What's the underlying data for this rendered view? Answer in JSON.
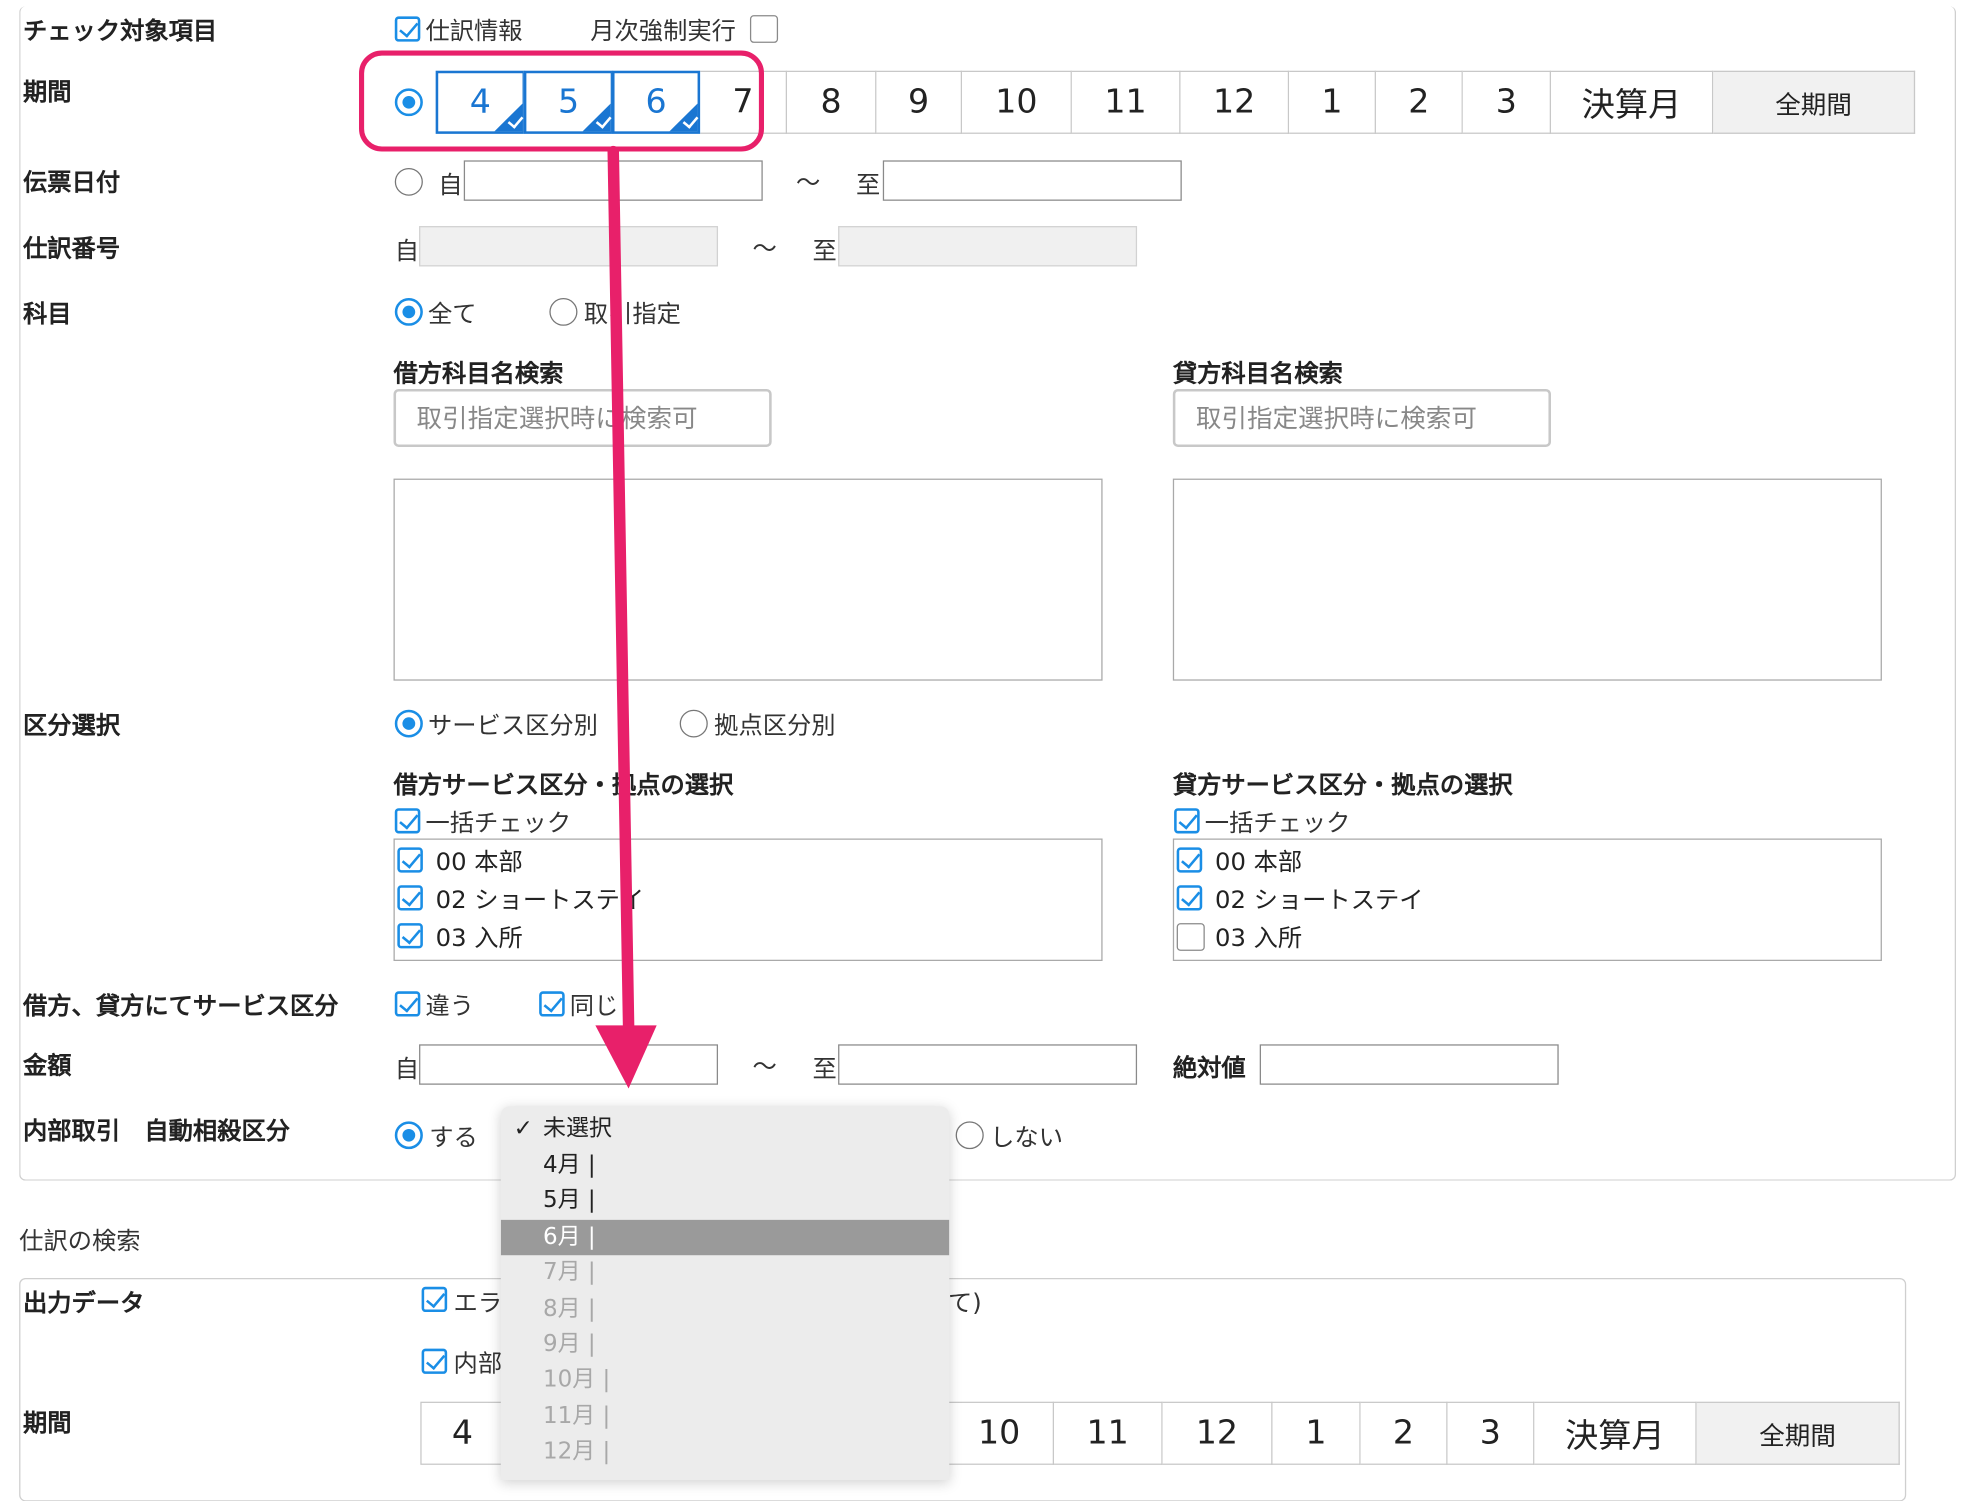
{
  "check": {
    "heading": "チェック対象項目",
    "shiwake_label": "仕訳情報",
    "getsuji_label": "月次強制実行"
  },
  "period": {
    "label": "期間",
    "months": [
      "4",
      "5",
      "6",
      "7",
      "8",
      "9",
      "10",
      "11",
      "12",
      "1",
      "2",
      "3",
      "決算月"
    ],
    "selected": [
      "4",
      "5",
      "6"
    ],
    "all_label": "全期間"
  },
  "voucher_date": {
    "label": "伝票日付",
    "from": "自",
    "tilde": "〜",
    "to": "至"
  },
  "entry_number": {
    "label": "仕訳番号",
    "from": "自",
    "tilde": "〜",
    "to": "至"
  },
  "account": {
    "label": "科目",
    "opt_all": "全て",
    "opt_specified": "取引指定",
    "debit_search_title": "借方科目名検索",
    "credit_search_title": "貸方科目名検索",
    "search_placeholder": "取引指定選択時に検索可"
  },
  "division": {
    "label": "区分選択",
    "opt_service": "サービス区分別",
    "opt_base": "拠点区分別",
    "debit_title": "借方サービス区分・拠点の選択",
    "credit_title": "貸方サービス区分・拠点の選択",
    "bulk_check": "一括チェック",
    "debit_items": [
      {
        "label": "00 本部",
        "checked": true
      },
      {
        "label": "02 ショートステイ",
        "checked": true
      },
      {
        "label": "03 入所",
        "checked": true
      }
    ],
    "credit_items": [
      {
        "label": "00 本部",
        "checked": true
      },
      {
        "label": "02 ショートステイ",
        "checked": true
      },
      {
        "label": "03 入所",
        "checked": false
      }
    ]
  },
  "service_compare": {
    "label": "借方、貸方にてサービス区分",
    "diff": "違う",
    "same": "同じ"
  },
  "amount": {
    "label": "金額",
    "from": "自",
    "tilde": "〜",
    "to": "至",
    "abs_label": "絶対値"
  },
  "internal": {
    "label": "内部取引　自動相殺区分",
    "opt_yes": "する",
    "opt_no": "しない"
  },
  "dropdown": {
    "items": [
      {
        "label": "未選択",
        "checked": true,
        "state": "normal"
      },
      {
        "label": "4月 |",
        "state": "normal"
      },
      {
        "label": "5月 |",
        "state": "normal"
      },
      {
        "label": "6月 |",
        "state": "highlight"
      },
      {
        "label": "7月 |",
        "state": "disabled"
      },
      {
        "label": "8月 |",
        "state": "disabled"
      },
      {
        "label": "9月 |",
        "state": "disabled"
      },
      {
        "label": "10月 |",
        "state": "disabled"
      },
      {
        "label": "11月 |",
        "state": "disabled"
      },
      {
        "label": "12月 |",
        "state": "disabled"
      }
    ],
    "check_mark": "✓"
  },
  "search_section": {
    "title": "仕訳の検索",
    "output_label": "出力データ",
    "error_label": "エラ",
    "all_suffix": "て)",
    "internal_label": "内部",
    "period_label": "期間",
    "months_bottom": [
      "4",
      "10",
      "11",
      "12",
      "1",
      "2",
      "3",
      "決算月"
    ],
    "all_label": "全期間"
  },
  "colors": {
    "accent": "#1a76d2",
    "highlight": "#e8206a"
  }
}
